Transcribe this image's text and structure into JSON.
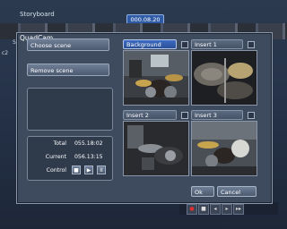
{
  "storyboard": {
    "title": "Storyboard",
    "timecode": "000.08.20",
    "left_labels": [
      "S",
      "c2"
    ],
    "transport_glyphs": [
      "●",
      "■",
      "◂",
      "▸",
      "▸▸"
    ]
  },
  "dialog": {
    "title": "QuadCam",
    "buttons": {
      "choose_scene": "Choose scene",
      "remove_scene": "Remove scene",
      "ok": "Ok",
      "cancel": "Cancel"
    },
    "total_label": "Total",
    "total_value": "055.18:02",
    "current_label": "Current",
    "current_value": "056.13:15",
    "control_label": "Control",
    "control_glyphs": {
      "stop": "■",
      "play": "▶",
      "pause": "II"
    },
    "video_slots": [
      {
        "label": "Background",
        "selected": true
      },
      {
        "label": "Insert 1",
        "selected": false
      },
      {
        "label": "Insert 2",
        "selected": false
      },
      {
        "label": "Insert 3",
        "selected": false
      }
    ]
  },
  "colors": {
    "selected_header": "#3d6cc3",
    "dialog_bg": "#3e4b5e",
    "timecode_bg": "#2f5aa5"
  }
}
